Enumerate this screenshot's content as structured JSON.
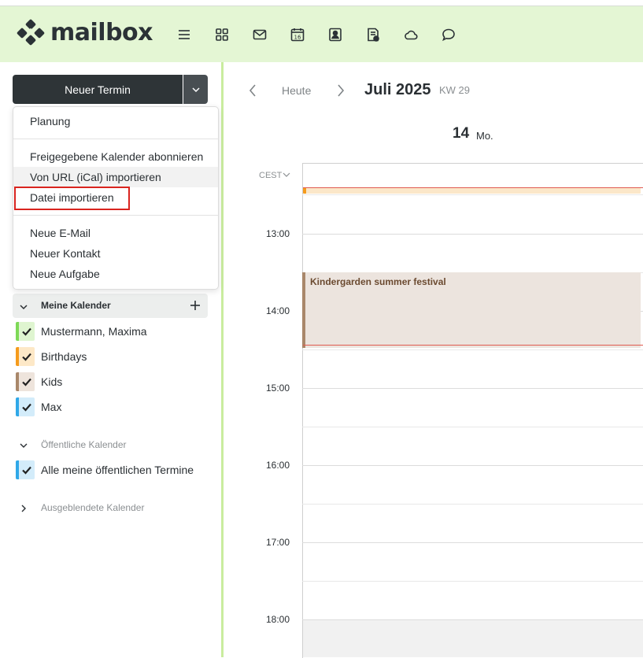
{
  "app": {
    "logo_text": "mailbox"
  },
  "nav_icons": [
    "menu-icon",
    "apps-grid-icon",
    "mail-icon",
    "calendar-icon",
    "contacts-icon",
    "tasks-icon",
    "cloud-icon",
    "chat-icon"
  ],
  "calendar_icon_day": "16",
  "sidebar": {
    "new_event_label": "Neuer Termin",
    "dropdown": {
      "items": [
        "Planung",
        "Freigegebene Kalender abonnieren",
        "Von URL (iCal) importieren",
        "Datei importieren",
        "Neue E-Mail",
        "Neuer Kontakt",
        "Neue Aufgabe"
      ]
    },
    "my_calendars_title": "Meine Kalender",
    "my_calendars": [
      {
        "label": "Mustermann, Maxima",
        "color": "#7ed957",
        "bg": "#dff5d0"
      },
      {
        "label": "Birthdays",
        "color": "#f59b1c",
        "bg": "#fde8c7"
      },
      {
        "label": "Kids",
        "color": "#a9876a",
        "bg": "#eee4dc"
      },
      {
        "label": "Max",
        "color": "#2fa8e8",
        "bg": "#d3ecfa"
      }
    ],
    "public_title": "Öffentliche Kalender",
    "public_calendars": [
      {
        "label": "Alle meine öffentlichen Termine",
        "color": "#2fa8e8",
        "bg": "#d3ecfa"
      }
    ],
    "hidden_title": "Ausgeblendete Kalender"
  },
  "toolbar": {
    "today_label": "Heute",
    "month_label": "Juli 2025",
    "week_label": "KW 29"
  },
  "day_header": {
    "day_number": "14",
    "day_name": "Mo."
  },
  "timezone": "CEST",
  "hours": [
    "13:00",
    "14:00",
    "15:00",
    "16:00",
    "17:00",
    "18:00"
  ],
  "event": {
    "title": "Kindergarden summer festival"
  },
  "colors": {
    "accent": "#c9ec9e",
    "header_bg": "#e4f6d4",
    "highlight": "#d9241f"
  }
}
